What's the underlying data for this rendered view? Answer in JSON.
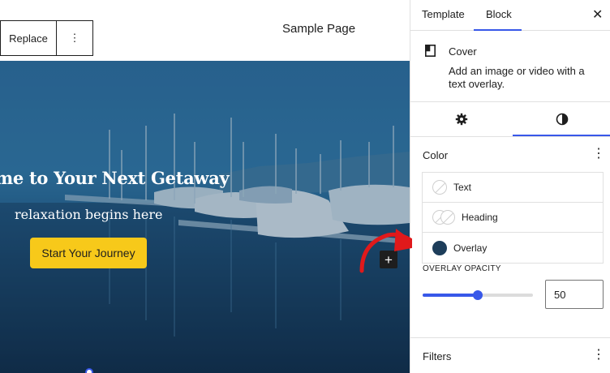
{
  "toolbar": {
    "replace_label": "Replace",
    "more_icon": "vertical-ellipsis-icon"
  },
  "page": {
    "title": "Sample Page"
  },
  "cover": {
    "heading": "me to Your Next Getaway",
    "subheading": "relaxation begins here",
    "button_label": "Start Your Journey",
    "button_color": "#f7c91a",
    "overlay_color": "#1d3d5a",
    "add_block_icon": "plus-icon"
  },
  "sidebar": {
    "tabs": [
      {
        "label": "Template"
      },
      {
        "label": "Block"
      }
    ],
    "active_tab": "Block",
    "close_icon": "close-icon",
    "block": {
      "icon": "cover-block-icon",
      "title": "Cover",
      "description": "Add an image or video with a text overlay."
    },
    "sub_tabs": [
      {
        "icon": "gear-icon",
        "name": "Settings"
      },
      {
        "icon": "half-circle-contrast-icon",
        "name": "Styles"
      }
    ],
    "active_sub_tab": "Styles",
    "color": {
      "title": "Color",
      "items": [
        {
          "label": "Text"
        },
        {
          "label": "Heading"
        },
        {
          "label": "Overlay",
          "color": "#1d3d5a"
        }
      ]
    },
    "overlay_opacity": {
      "label": "OVERLAY OPACITY",
      "value": "50",
      "fraction": 0.5
    },
    "filters": {
      "title": "Filters"
    }
  },
  "annotation": {
    "arrow_color": "#e0191b"
  },
  "colors": {
    "accent": "#3858e9",
    "text": "#1e1e1e",
    "border": "#e0e0e0"
  }
}
